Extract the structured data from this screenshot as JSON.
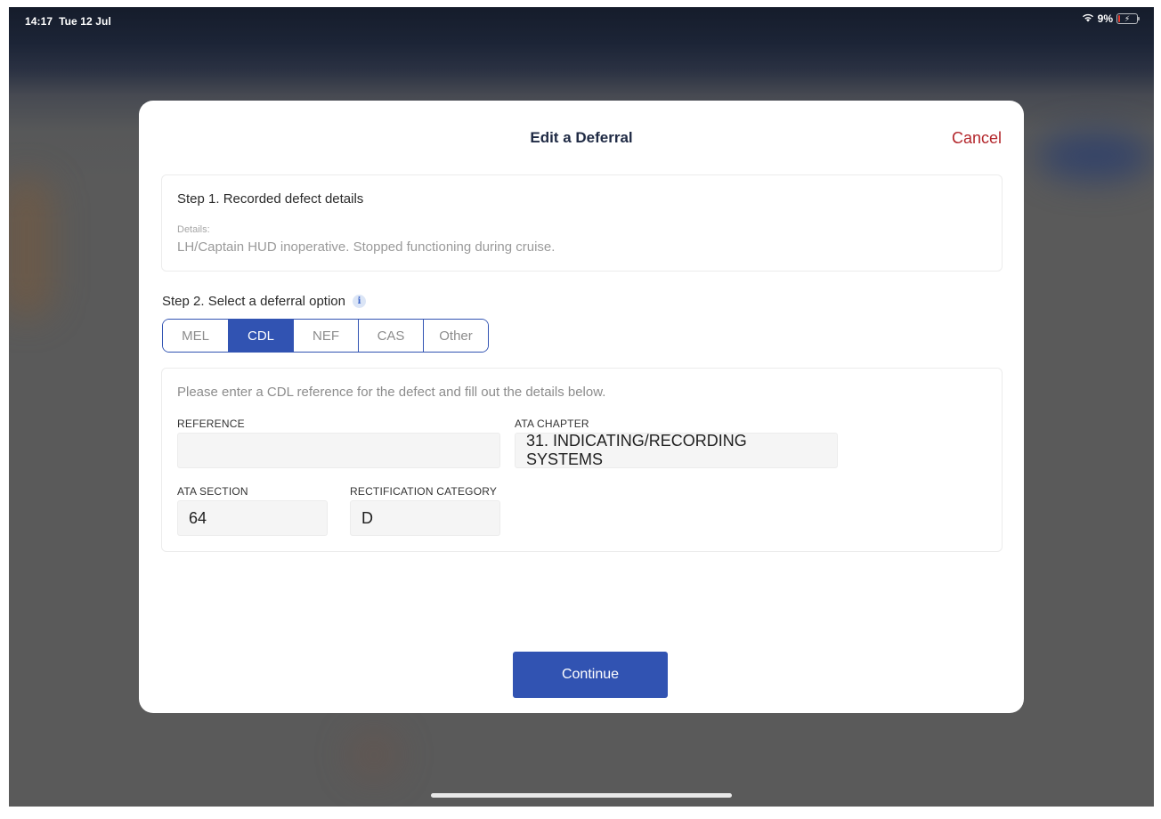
{
  "status_bar": {
    "time": "14:17",
    "date": "Tue 12 Jul",
    "wifi_icon": "wifi-icon",
    "battery_percent": "9%",
    "battery_level": 0.09,
    "battery_charging": true,
    "battery_color": "#e53a2f"
  },
  "modal": {
    "title": "Edit a Deferral",
    "cancel_label": "Cancel",
    "cancel_color": "#b3262b"
  },
  "step1": {
    "title": "Step 1. Recorded defect details",
    "details_label": "Details:",
    "details_value": "LH/Captain HUD inoperative. Stopped functioning during cruise."
  },
  "step2": {
    "title": "Step 2. Select a deferral option",
    "info_icon": "info-icon",
    "options": [
      {
        "label": "MEL",
        "selected": false
      },
      {
        "label": "CDL",
        "selected": true
      },
      {
        "label": "NEF",
        "selected": false
      },
      {
        "label": "CAS",
        "selected": false
      },
      {
        "label": "Other",
        "selected": false
      }
    ],
    "accent_color": "#3153b2"
  },
  "form": {
    "hint": "Please enter a CDL reference for the defect and fill out the details below.",
    "reference": {
      "label": "REFERENCE",
      "value": ""
    },
    "ata_chapter": {
      "label": "ATA CHAPTER",
      "value": "31. INDICATING/RECORDING SYSTEMS"
    },
    "ata_section": {
      "label": "ATA SECTION",
      "value": "64"
    },
    "rectification_category": {
      "label": "RECTIFICATION CATEGORY",
      "value": "D"
    }
  },
  "actions": {
    "continue_label": "Continue"
  }
}
